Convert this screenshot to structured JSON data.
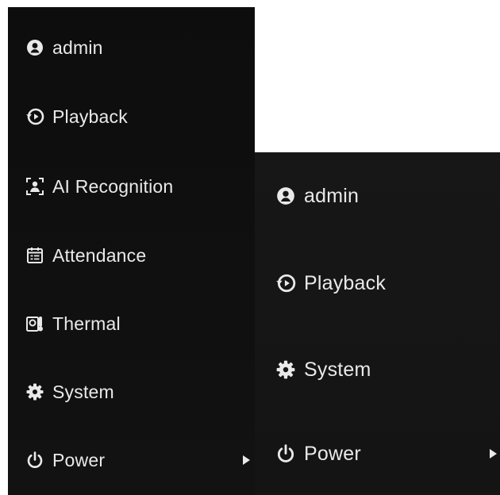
{
  "left_menu": {
    "items": [
      {
        "label": "admin",
        "icon": "user-icon"
      },
      {
        "label": "Playback",
        "icon": "playback-icon"
      },
      {
        "label": "AI Recognition",
        "icon": "ai-recognition-icon"
      },
      {
        "label": "Attendance",
        "icon": "attendance-icon"
      },
      {
        "label": "Thermal",
        "icon": "thermal-icon"
      },
      {
        "label": "System",
        "icon": "gear-icon"
      },
      {
        "label": "Power",
        "icon": "power-icon",
        "submenu_arrow": "chevron-right-icon"
      }
    ]
  },
  "right_menu": {
    "items": [
      {
        "label": "admin",
        "icon": "user-icon"
      },
      {
        "label": "Playback",
        "icon": "playback-icon"
      },
      {
        "label": "System",
        "icon": "gear-icon"
      },
      {
        "label": "Power",
        "icon": "power-icon",
        "submenu_arrow": "chevron-right-icon"
      }
    ]
  },
  "colors": {
    "menu_background": "#101010",
    "text": "#e9e9e9",
    "page_background": "#ffffff"
  }
}
